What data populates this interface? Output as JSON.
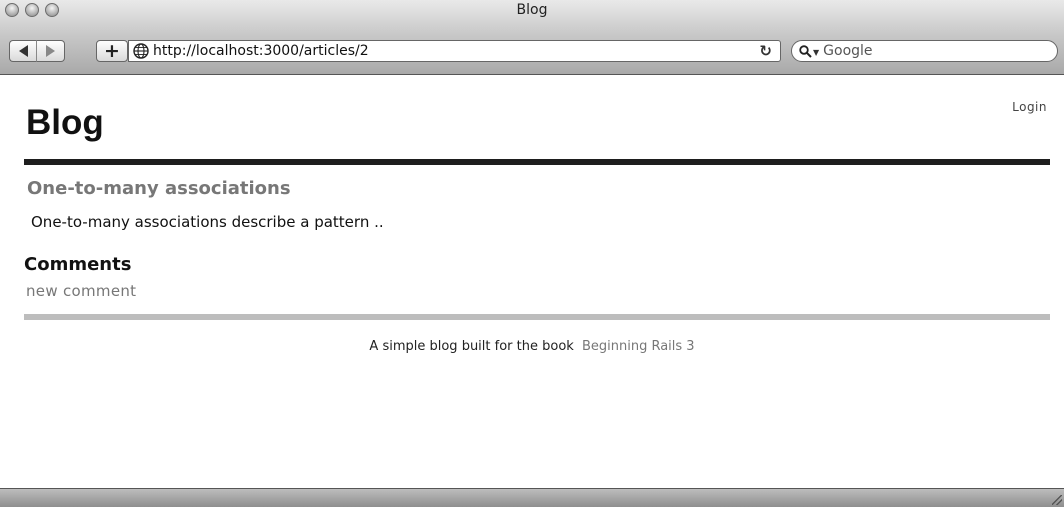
{
  "window": {
    "title": "Blog"
  },
  "toolbar": {
    "add_label": "+",
    "url": "http://localhost:3000/articles/2",
    "reload_glyph": "↻",
    "search_placeholder": "Google"
  },
  "icons": {
    "back": "back-arrow-icon",
    "forward": "forward-arrow-icon",
    "globe": "globe-icon",
    "reload": "reload-icon",
    "search": "search-icon"
  },
  "page": {
    "login_link": "Login",
    "site_title": "Blog",
    "article": {
      "title": "One-to-many associations",
      "body": "One-to-many associations describe a pattern .."
    },
    "comments_heading": "Comments",
    "new_comment_link": "new comment",
    "footer": {
      "text": "A simple blog built for the book",
      "link": "Beginning Rails 3"
    }
  },
  "colors": {
    "title_rule": "#1e1e1e",
    "footer_rule": "#bdbdbd",
    "link_gray": "#777777"
  }
}
